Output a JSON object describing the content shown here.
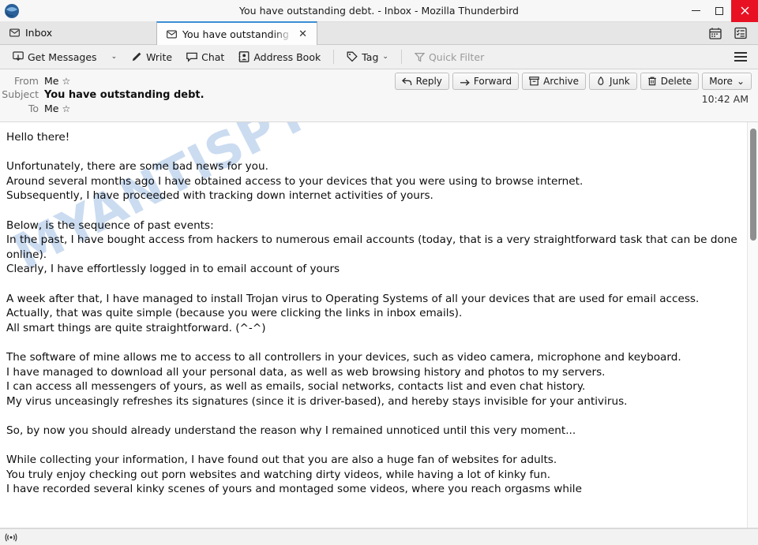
{
  "window": {
    "title": "You have outstanding debt. - Inbox - Mozilla Thunderbird",
    "app_logo": "thunderbird-logo-icon",
    "minimize_label": "Minimize",
    "maximize_label": "Maximize",
    "close_label": "Close"
  },
  "tabs": [
    {
      "label": "Inbox",
      "icon": "envelope-icon",
      "active": false
    },
    {
      "label": "You have outstanding",
      "icon": "envelope-icon",
      "active": true,
      "close": "✕"
    }
  ],
  "tabbar_right": {
    "calendar_icon": "calendar-icon",
    "tasks_icon": "tasks-icon"
  },
  "toolbar": {
    "get_messages": "Get Messages",
    "get_messages_caret": "⌄",
    "write": "Write",
    "chat": "Chat",
    "address_book": "Address Book",
    "tag": "Tag",
    "tag_caret": "⌄",
    "quick_filter": "Quick Filter",
    "app_menu": "app-menu"
  },
  "message_actions": [
    {
      "label": "Reply",
      "icon": "reply-arrow-icon"
    },
    {
      "label": "Forward",
      "icon": "forward-arrow-icon"
    },
    {
      "label": "Archive",
      "icon": "archive-box-icon"
    },
    {
      "label": "Junk",
      "icon": "junk-flame-icon"
    },
    {
      "label": "Delete",
      "icon": "trash-icon"
    },
    {
      "label": "More",
      "icon": "chevron-down-icon",
      "caret": "⌄"
    }
  ],
  "message_header": {
    "from_label": "From",
    "from_value": "Me",
    "subject_label": "Subject",
    "subject_value": "You have outstanding debt.",
    "to_label": "To",
    "to_value": "Me",
    "star": "☆",
    "time": "10:42 AM"
  },
  "watermark": "MYANTISPYWARE.COM",
  "body_lines": [
    "Hello there!",
    "",
    "Unfortunately, there are some bad news for you.",
    "Around several months ago I have obtained access to your devices that you were using to browse internet.",
    "Subsequently, I have proceeded with tracking down internet activities of yours.",
    "",
    "Below, is the sequence of past events:",
    "In the past, I have bought access from hackers to numerous email accounts (today, that is a very straightforward task that can be done online).",
    "Clearly, I have effortlessly logged in to email account of yours",
    "",
    "A week after that, I have managed to install Trojan virus to Operating Systems of all your devices that are used for email access.",
    "Actually, that was quite simple (because you were clicking the links in inbox emails).",
    "All smart things are quite straightforward. (^-^)",
    "",
    "The software of mine allows me to access to all controllers in your devices, such as video camera, microphone and keyboard.",
    "I have managed to download all your personal data, as well as web browsing history and photos to my servers.",
    "I can access all messengers of yours, as well as emails, social networks, contacts list and even chat history.",
    "My virus unceasingly refreshes its signatures (since it is driver-based), and hereby stays invisible for your antivirus.",
    "",
    "So, by now you should already understand the reason why I remained unnoticed until this very moment...",
    "",
    "While collecting your information, I have found out that you are also a huge fan of websites for adults.",
    "You truly enjoy checking out porn websites and watching dirty videos, while having a lot of kinky fun.",
    "I have recorded several kinky scenes of yours and montaged some videos, where you reach orgasms while"
  ],
  "statusbar": {
    "connection_icon": "wireless-signal-icon",
    "text": ""
  },
  "colors": {
    "close_red": "#e81123",
    "active_tab_accent": "#3a8fd4",
    "watermark_blue": "#c3d6ef"
  }
}
